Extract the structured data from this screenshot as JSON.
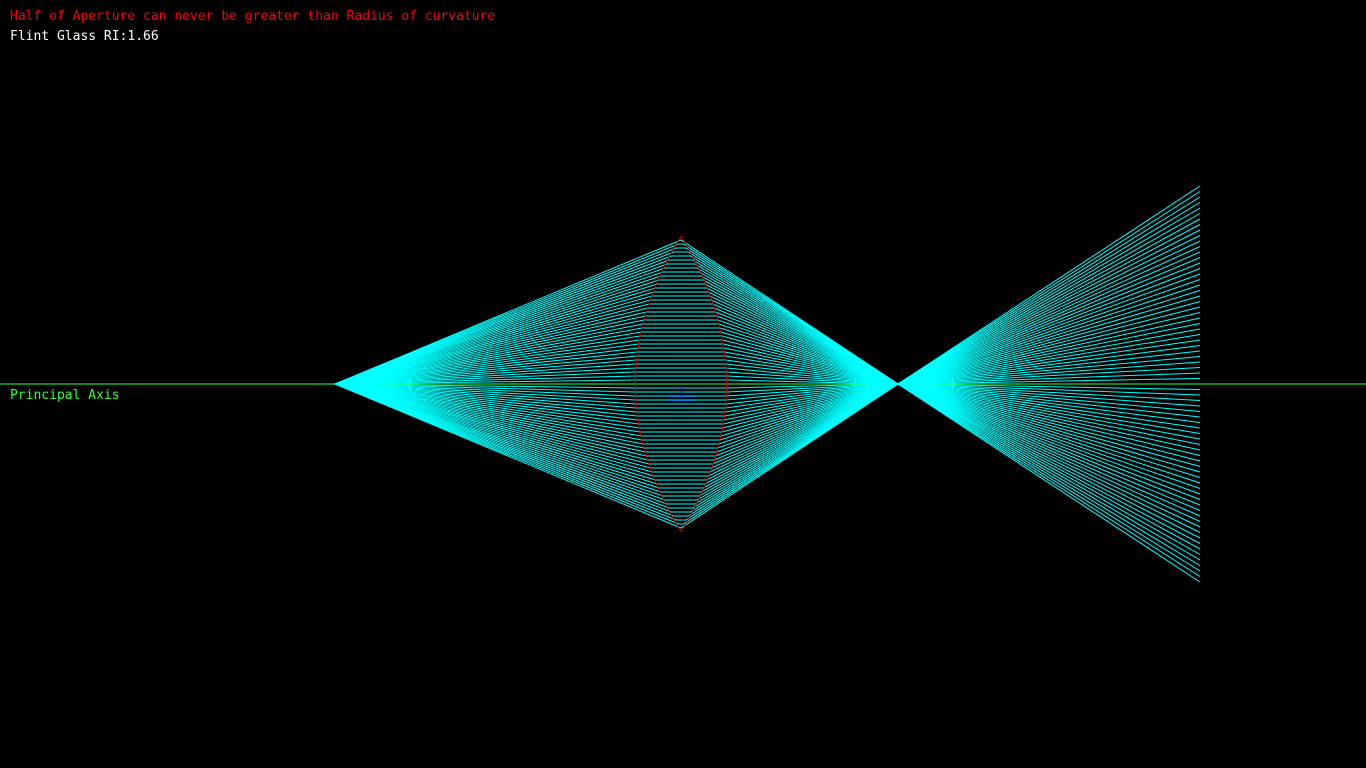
{
  "warning": {
    "text": "Half of Aperture can never be greater than Radius of curvature",
    "color": "#ff0000"
  },
  "material": {
    "text": "Flint Glass RI:1.66",
    "color": "#ffffff"
  },
  "axis": {
    "label": "Principal Axis",
    "color": "#33ff33"
  },
  "lens": {
    "outline_color": "#cc0000",
    "center_label_color": "#0000cc"
  },
  "rays": {
    "color": "#00ffff",
    "count_per_side": 36
  }
}
